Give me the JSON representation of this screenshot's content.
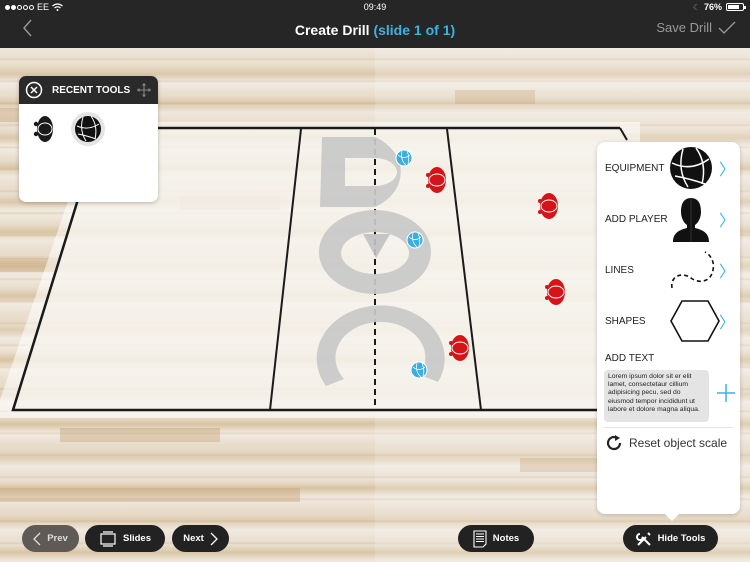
{
  "status_bar": {
    "carrier": "EE",
    "signal_bars": 2,
    "signal_total": 5,
    "time": "09:49",
    "battery_percent": "76%",
    "battery_level": 0.76
  },
  "nav": {
    "back_icon": "chevron-left-icon",
    "title": "Create Drill",
    "subtitle": "(slide 1 of 1)",
    "save_label": "Save Drill",
    "save_icon": "checkmark-icon"
  },
  "recent_tools": {
    "title": "RECENT TOOLS",
    "close_icon": "close-circle-icon",
    "move_icon": "move-arrows-icon",
    "items": [
      {
        "name": "player",
        "icon": "player-topdown-icon"
      },
      {
        "name": "volleyball",
        "icon": "volleyball-icon"
      }
    ]
  },
  "tools_panel": {
    "rows": [
      {
        "label": "EQUIPMENT",
        "icon": "volleyball-icon"
      },
      {
        "label": "ADD PLAYER",
        "icon": "player-silhouette-icon"
      },
      {
        "label": "LINES",
        "icon": "dashed-curve-icon"
      },
      {
        "label": "SHAPES",
        "icon": "hexagon-icon"
      }
    ],
    "add_text_label": "ADD TEXT",
    "text_sample": "Lorem ipsum dolor sit er elit lamet, consectetaur cillium adipisicing pecu, sed do eiusmod tempor incididunt ut labore et dolore magna aliqua.",
    "add_icon": "plus-icon",
    "reset_label": "Reset object scale",
    "reset_icon": "refresh-icon"
  },
  "bottom_bar": {
    "prev_label": "Prev",
    "slides_label": "Slides",
    "next_label": "Next",
    "notes_label": "Notes",
    "hide_tools_label": "Hide Tools"
  },
  "drill": {
    "court_type": "volleyball",
    "letters": "DOC",
    "colors": {
      "player": "#d41418",
      "ball": "#3aaee0",
      "letters": "#c9c9c9",
      "accent": "#3ab4e6"
    }
  }
}
